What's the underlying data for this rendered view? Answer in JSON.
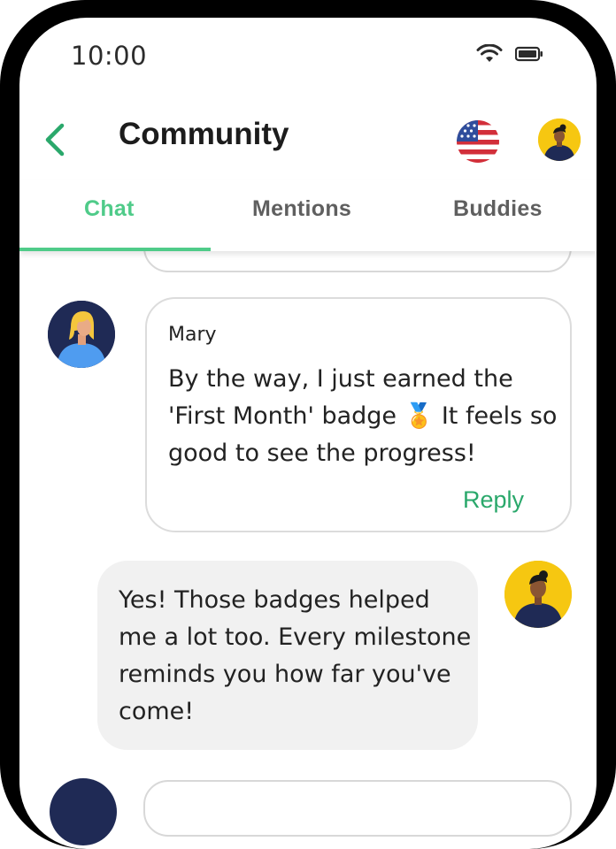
{
  "status": {
    "time": "10:00"
  },
  "header": {
    "title": "Community"
  },
  "tabs": [
    {
      "label": "Chat",
      "active": true
    },
    {
      "label": "Mentions",
      "active": false
    },
    {
      "label": "Buddies",
      "active": false
    }
  ],
  "messages": [
    {
      "author": "Mary",
      "text": "By the way, I just earned the 'First Month' badge 🏅 It feels so good to see the progress!",
      "reply_label": "Reply"
    },
    {
      "text": "Yes! Those badges helped me a lot too. Every milestone reminds you how far you've come!"
    }
  ],
  "colors": {
    "accent": "#4fcb89",
    "reply": "#2aa86b",
    "bubble_out": "#f1f1f1"
  },
  "icons": [
    "back-arrow-icon",
    "wifi-icon",
    "battery-icon",
    "us-flag-icon"
  ]
}
